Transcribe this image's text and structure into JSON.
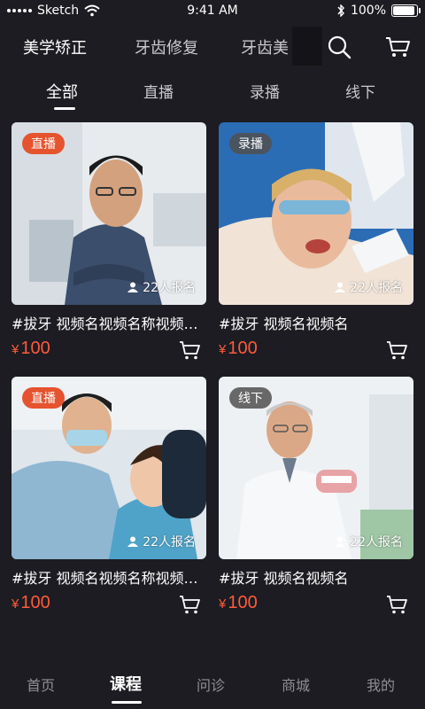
{
  "status_bar": {
    "carrier": "Sketch",
    "time": "9:41 AM",
    "battery": "100%"
  },
  "top_nav": {
    "categories": [
      "美学矫正",
      "牙齿修复",
      "牙齿美"
    ],
    "search_icon": "search-icon",
    "cart_icon": "cart-icon"
  },
  "tabs": [
    {
      "label": "全部",
      "active": true
    },
    {
      "label": "直播",
      "active": false
    },
    {
      "label": "录播",
      "active": false
    },
    {
      "label": "线下",
      "active": false
    }
  ],
  "courses": [
    {
      "badge": "直播",
      "badge_type": "live",
      "enroll": "22人报名",
      "title": "#拔牙 视频名视频名称视频名称",
      "currency": "¥",
      "price": "100"
    },
    {
      "badge": "录播",
      "badge_type": "rec",
      "enroll": "22人报名",
      "title": "#拔牙 视频名视频名",
      "currency": "¥",
      "price": "100"
    },
    {
      "badge": "直播",
      "badge_type": "live",
      "enroll": "22人报名",
      "title": "#拔牙 视频名视频名称视频名称",
      "currency": "¥",
      "price": "100"
    },
    {
      "badge": "线下",
      "badge_type": "off",
      "enroll": "22人报名",
      "title": "#拔牙 视频名视频名",
      "currency": "¥",
      "price": "100"
    }
  ],
  "bottom_tabs": [
    {
      "label": "首页",
      "active": false
    },
    {
      "label": "课程",
      "active": true
    },
    {
      "label": "问诊",
      "active": false
    },
    {
      "label": "商城",
      "active": false
    },
    {
      "label": "我的",
      "active": false
    }
  ],
  "colors": {
    "background": "#1c1c22",
    "price": "#ff5a3c",
    "live_badge": "#e5532f"
  }
}
